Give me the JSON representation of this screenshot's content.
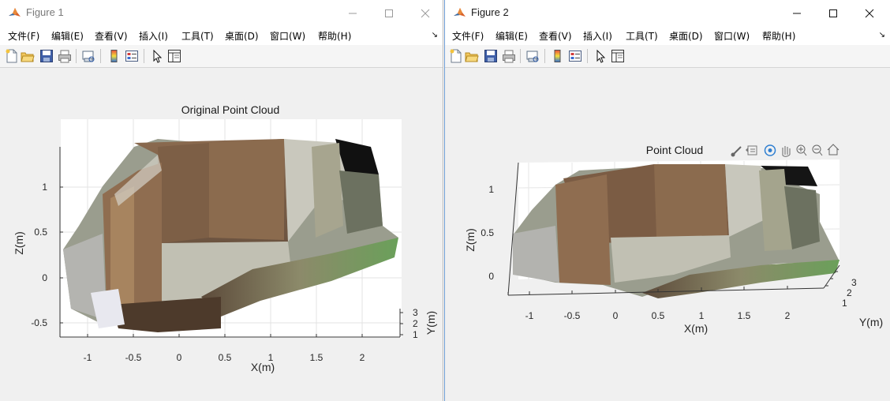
{
  "windows": [
    {
      "title": "Figure 1",
      "menus": [
        "文件(F)",
        "编辑(E)",
        "查看(V)",
        "插入(I)",
        "工具(T)",
        "桌面(D)",
        "窗口(W)",
        "帮助(H)"
      ],
      "plot": {
        "title": "Original Point Cloud",
        "xlabel": "X(m)",
        "ylabel": "Y(m)",
        "zlabel": "Z(m)",
        "x_ticks": [
          "-1",
          "-0.5",
          "0",
          "0.5",
          "1",
          "1.5",
          "2"
        ],
        "y_ticks": [
          "1",
          "2",
          "3"
        ],
        "z_ticks": [
          "-0.5",
          "0",
          "0.5",
          "1"
        ]
      }
    },
    {
      "title": "Figure 2",
      "menus": [
        "文件(F)",
        "编辑(E)",
        "查看(V)",
        "插入(I)",
        "工具(T)",
        "桌面(D)",
        "窗口(W)",
        "帮助(H)"
      ],
      "plot": {
        "title": "Point Cloud",
        "xlabel": "X(m)",
        "ylabel": "Y(m)",
        "zlabel": "Z(m)",
        "x_ticks": [
          "-1",
          "-0.5",
          "0",
          "0.5",
          "1",
          "1.5",
          "2"
        ],
        "y_ticks": [
          "1",
          "2",
          "3"
        ],
        "z_ticks": [
          "0",
          "0.5",
          "1"
        ]
      }
    }
  ],
  "toolbar_icons": [
    "new-figure-icon",
    "open-file-icon",
    "save-icon",
    "print-icon",
    "print-preview-icon",
    "insert-colorbar-icon",
    "insert-legend-icon",
    "edit-plot-icon",
    "property-inspector-icon"
  ],
  "axes_toolbar_icons": [
    "brush-icon",
    "data-tips-icon",
    "rotate-3d-icon",
    "pan-icon",
    "zoom-in-icon",
    "zoom-out-icon",
    "home-icon"
  ],
  "colors": {
    "title_bar": "#ffffff",
    "menu_bar": "#ffffff",
    "toolbar": "#f5f5f5",
    "figure_bg": "#f0f0f0",
    "axes_bg": "#ffffff",
    "active_border": "#6c9bd2"
  }
}
